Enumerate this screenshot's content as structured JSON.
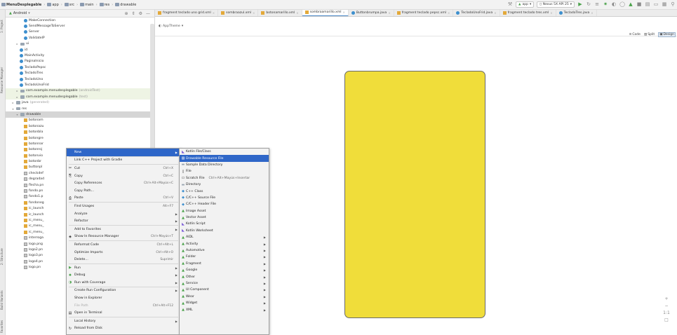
{
  "navbar": {
    "breadcrumbs": [
      {
        "label": "MenuDesplegable",
        "icon": "folder-icon",
        "bold": true
      },
      {
        "label": "app",
        "icon": "folder-icon"
      },
      {
        "label": "src",
        "icon": "folder-icon"
      },
      {
        "label": "main",
        "icon": "folder-icon"
      },
      {
        "label": "res",
        "icon": "folder-icon"
      },
      {
        "label": "drawable",
        "icon": "folder-icon"
      }
    ],
    "run_config": "app",
    "device": "Nexus 5X API 25"
  },
  "left_stripe": {
    "project_label": "1: Project",
    "resource_manager_label": "Resource Manager",
    "structure_label": "2: Structure",
    "build_variants_label": "Build Variants",
    "favorites_label": "Favorites"
  },
  "project_panel": {
    "view_mode": "Android",
    "items": [
      {
        "label": "MakeConnection",
        "icon": "class-icon",
        "indent": 26
      },
      {
        "label": "SendMessageToServer",
        "icon": "class-icon",
        "indent": 26
      },
      {
        "label": "Server",
        "icon": "class-icon",
        "indent": 26
      },
      {
        "label": "ValidateIP",
        "icon": "class-icon",
        "indent": 26
      },
      {
        "label": "ui",
        "icon": "folder-icon",
        "indent": 14,
        "arrow": "right"
      },
      {
        "label": "id",
        "icon": "class-icon",
        "indent": 20
      },
      {
        "label": "MainActivity",
        "icon": "class-icon",
        "indent": 20
      },
      {
        "label": "PaginaInicio",
        "icon": "class-icon",
        "indent": 20
      },
      {
        "label": "TecladoPepsc",
        "icon": "class-icon",
        "indent": 20
      },
      {
        "label": "TecladoTres",
        "icon": "class-icon",
        "indent": 20
      },
      {
        "label": "TecladoUno",
        "icon": "class-icon",
        "indent": 20
      },
      {
        "label": "TecladoUnoFrid",
        "icon": "class-icon",
        "indent": 20
      },
      {
        "label": "com.example.menudesplegable",
        "suffix": "(androidTest)",
        "icon": "folder-icon",
        "indent": 14,
        "arrow": "right",
        "highlight": true
      },
      {
        "label": "com.example.menudesplegable",
        "suffix": "(test)",
        "icon": "folder-icon",
        "indent": 14,
        "arrow": "right",
        "highlight": true
      },
      {
        "label": "java",
        "suffix": "(generated)",
        "icon": "folder-icon",
        "indent": 8,
        "arrow": "right"
      },
      {
        "label": "res",
        "icon": "folder-icon",
        "indent": 8,
        "arrow": "down"
      },
      {
        "label": "drawable",
        "icon": "folder-icon",
        "indent": 14,
        "arrow": "down",
        "selected": true
      },
      {
        "label": "botonam",
        "icon": "xml-icon",
        "indent": 26
      },
      {
        "label": "botonazu",
        "icon": "xml-icon",
        "indent": 26
      },
      {
        "label": "botonbla",
        "icon": "xml-icon",
        "indent": 26
      },
      {
        "label": "botongre",
        "icon": "xml-icon",
        "indent": 26
      },
      {
        "label": "botonnar",
        "icon": "xml-icon",
        "indent": 26
      },
      {
        "label": "botonroj",
        "icon": "xml-icon",
        "indent": 26
      },
      {
        "label": "botonvio",
        "icon": "xml-icon",
        "indent": 26
      },
      {
        "label": "botonbr",
        "icon": "xml-icon",
        "indent": 26
      },
      {
        "label": "buttonpl",
        "icon": "xml-icon",
        "indent": 26
      },
      {
        "label": "checkdef",
        "icon": "image-icon",
        "indent": 26
      },
      {
        "label": "degradad",
        "icon": "image-icon",
        "indent": 26
      },
      {
        "label": "flecha.pn",
        "icon": "image-icon",
        "indent": 26
      },
      {
        "label": "fondo.pn",
        "icon": "image-icon",
        "indent": 26
      },
      {
        "label": "fondo1.p",
        "icon": "image-icon",
        "indent": 26
      },
      {
        "label": "fondoneg",
        "icon": "xml-icon",
        "indent": 26
      },
      {
        "label": "ic_launch",
        "icon": "xml-icon",
        "indent": 26
      },
      {
        "label": "ic_launch",
        "icon": "xml-icon",
        "indent": 26
      },
      {
        "label": "ic_menu_",
        "icon": "xml-icon",
        "indent": 26
      },
      {
        "label": "ic_menu_",
        "icon": "xml-icon",
        "indent": 26
      },
      {
        "label": "ic_menu_",
        "icon": "xml-icon",
        "indent": 26
      },
      {
        "label": "interroga",
        "icon": "image-icon",
        "indent": 26
      },
      {
        "label": "logo.png",
        "icon": "image-icon",
        "indent": 26
      },
      {
        "label": "logo2.pn",
        "icon": "image-icon",
        "indent": 26
      },
      {
        "label": "logo3.pn",
        "icon": "image-icon",
        "indent": 26
      },
      {
        "label": "logo4.pn",
        "icon": "image-icon",
        "indent": 26
      },
      {
        "label": "logo.pn",
        "icon": "image-icon",
        "indent": 26
      }
    ]
  },
  "tabs": [
    {
      "label": "fragment teclado uno grid.xml",
      "icon": "xml-icon"
    },
    {
      "label": "sombraazul.xml",
      "icon": "xml-icon"
    },
    {
      "label": "botonamarillo.xml",
      "icon": "xml-icon"
    },
    {
      "label": "sombraamarillo.xml",
      "icon": "xml-icon",
      "active": true
    },
    {
      "label": "Buttonbrumpa.java",
      "icon": "java-icon"
    },
    {
      "label": "fragment teclado pepsc.xml",
      "icon": "xml-icon"
    },
    {
      "label": "TecladoUnoFrid.java",
      "icon": "java-icon"
    },
    {
      "label": "fragment teclado tres.xml",
      "icon": "xml-icon"
    },
    {
      "label": "TecladoTres.java",
      "icon": "java-icon"
    }
  ],
  "editor": {
    "theme_label": "AppTheme",
    "modes": [
      "Code",
      "Split",
      "Design"
    ],
    "active_mode": "Design",
    "preview_color": "#f0dd3a"
  },
  "context_menu": {
    "items": [
      {
        "label": "New",
        "submenu": true,
        "active": true
      },
      {
        "sep": true
      },
      {
        "label": "Link C++ Project with Gradle"
      },
      {
        "sep": true
      },
      {
        "label": "Cut",
        "shortcut": "Ctrl+X",
        "icon": "cut-icon"
      },
      {
        "label": "Copy",
        "shortcut": "Ctrl+C",
        "icon": "copy-icon"
      },
      {
        "label": "Copy References",
        "shortcut": "Ctrl+Alt+Mayús+C"
      },
      {
        "label": "Copy Path..."
      },
      {
        "label": "Paste",
        "shortcut": "Ctrl+V",
        "icon": "paste-icon"
      },
      {
        "sep": true
      },
      {
        "label": "Find Usages",
        "shortcut": "Alt+F7"
      },
      {
        "label": "Analyze",
        "submenu": true
      },
      {
        "label": "Refactor",
        "submenu": true
      },
      {
        "sep": true
      },
      {
        "label": "Add to Favorites",
        "submenu": true
      },
      {
        "label": "Show In Resource Manager",
        "shortcut": "Ctrl+Mayús+T",
        "icon": "resource-icon"
      },
      {
        "sep": true
      },
      {
        "label": "Reformat Code",
        "shortcut": "Ctrl+Alt+L"
      },
      {
        "label": "Optimize Imports",
        "shortcut": "Ctrl+Alt+O"
      },
      {
        "label": "Delete...",
        "shortcut": "Suprimir"
      },
      {
        "sep": true
      },
      {
        "label": "Run",
        "submenu": true,
        "icon": "run-icon"
      },
      {
        "label": "Debug",
        "submenu": true,
        "icon": "debug-icon"
      },
      {
        "label": "Run with Coverage",
        "submenu": true,
        "icon": "coverage-icon"
      },
      {
        "sep": true
      },
      {
        "label": "Create Run Configuration",
        "submenu": true
      },
      {
        "label": "Show in Explorer"
      },
      {
        "label": "File Path",
        "shortcut": "Ctrl+Alt+F12",
        "disabled": true
      },
      {
        "label": "Open in Terminal",
        "icon": "terminal-icon"
      },
      {
        "sep": true
      },
      {
        "label": "Local History",
        "submenu": true
      },
      {
        "label": "Reload from Disk",
        "icon": "reload-icon"
      }
    ]
  },
  "submenu": {
    "items": [
      {
        "label": "Kotlin File/Class",
        "icon": "kotlin-icon"
      },
      {
        "label": "Drawable Resource File",
        "icon": "drawable-icon",
        "active": true
      },
      {
        "label": "Sample Data Directory",
        "icon": "folder-icon"
      },
      {
        "label": "File",
        "icon": "file-icon"
      },
      {
        "label": "Scratch File",
        "shortcut": "Ctrl+Alt+Mayús+Insertar",
        "icon": "scratch-icon"
      },
      {
        "label": "Directory",
        "icon": "folder-icon"
      },
      {
        "label": "C++ Class",
        "icon": "cpp-icon"
      },
      {
        "label": "C/C++ Source File",
        "icon": "cpp-icon"
      },
      {
        "label": "C/C++ Header File",
        "icon": "cpp-icon"
      },
      {
        "label": "Image Asset",
        "icon": "android-icon"
      },
      {
        "label": "Vector Asset",
        "icon": "android-icon"
      },
      {
        "label": "Kotlin Script",
        "icon": "kotlin-icon"
      },
      {
        "label": "Kotlin Worksheet",
        "icon": "kotlin-icon"
      },
      {
        "label": "AIDL",
        "submenu": true,
        "icon": "android-icon"
      },
      {
        "label": "Activity",
        "submenu": true,
        "icon": "android-icon"
      },
      {
        "label": "Automotive",
        "submenu": true,
        "icon": "android-icon"
      },
      {
        "label": "Folder",
        "submenu": true,
        "icon": "android-icon"
      },
      {
        "label": "Fragment",
        "submenu": true,
        "icon": "android-icon"
      },
      {
        "label": "Google",
        "submenu": true,
        "icon": "android-icon"
      },
      {
        "label": "Other",
        "submenu": true,
        "icon": "android-icon"
      },
      {
        "label": "Service",
        "submenu": true,
        "icon": "android-icon"
      },
      {
        "label": "UI Component",
        "submenu": true,
        "icon": "android-icon"
      },
      {
        "label": "Wear",
        "submenu": true,
        "icon": "android-icon"
      },
      {
        "label": "Widget",
        "submenu": true,
        "icon": "android-icon"
      },
      {
        "label": "XML",
        "submenu": true,
        "icon": "android-icon"
      }
    ]
  },
  "colors": {
    "accent": "#2e66c8",
    "selection": "#d5d5d5",
    "highlight_row": "#eef4e4",
    "preview_fill": "#f0dd3a"
  }
}
